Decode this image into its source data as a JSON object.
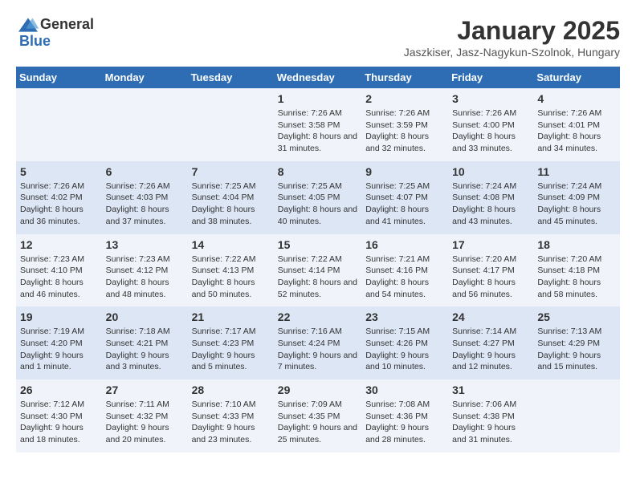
{
  "header": {
    "logo_general": "General",
    "logo_blue": "Blue",
    "title": "January 2025",
    "subtitle": "Jaszkiser, Jasz-Nagykun-Szolnok, Hungary"
  },
  "days_of_week": [
    "Sunday",
    "Monday",
    "Tuesday",
    "Wednesday",
    "Thursday",
    "Friday",
    "Saturday"
  ],
  "weeks": [
    [
      {
        "day": "",
        "info": ""
      },
      {
        "day": "",
        "info": ""
      },
      {
        "day": "",
        "info": ""
      },
      {
        "day": "1",
        "info": "Sunrise: 7:26 AM\nSunset: 3:58 PM\nDaylight: 8 hours and 31 minutes."
      },
      {
        "day": "2",
        "info": "Sunrise: 7:26 AM\nSunset: 3:59 PM\nDaylight: 8 hours and 32 minutes."
      },
      {
        "day": "3",
        "info": "Sunrise: 7:26 AM\nSunset: 4:00 PM\nDaylight: 8 hours and 33 minutes."
      },
      {
        "day": "4",
        "info": "Sunrise: 7:26 AM\nSunset: 4:01 PM\nDaylight: 8 hours and 34 minutes."
      }
    ],
    [
      {
        "day": "5",
        "info": "Sunrise: 7:26 AM\nSunset: 4:02 PM\nDaylight: 8 hours and 36 minutes."
      },
      {
        "day": "6",
        "info": "Sunrise: 7:26 AM\nSunset: 4:03 PM\nDaylight: 8 hours and 37 minutes."
      },
      {
        "day": "7",
        "info": "Sunrise: 7:25 AM\nSunset: 4:04 PM\nDaylight: 8 hours and 38 minutes."
      },
      {
        "day": "8",
        "info": "Sunrise: 7:25 AM\nSunset: 4:05 PM\nDaylight: 8 hours and 40 minutes."
      },
      {
        "day": "9",
        "info": "Sunrise: 7:25 AM\nSunset: 4:07 PM\nDaylight: 8 hours and 41 minutes."
      },
      {
        "day": "10",
        "info": "Sunrise: 7:24 AM\nSunset: 4:08 PM\nDaylight: 8 hours and 43 minutes."
      },
      {
        "day": "11",
        "info": "Sunrise: 7:24 AM\nSunset: 4:09 PM\nDaylight: 8 hours and 45 minutes."
      }
    ],
    [
      {
        "day": "12",
        "info": "Sunrise: 7:23 AM\nSunset: 4:10 PM\nDaylight: 8 hours and 46 minutes."
      },
      {
        "day": "13",
        "info": "Sunrise: 7:23 AM\nSunset: 4:12 PM\nDaylight: 8 hours and 48 minutes."
      },
      {
        "day": "14",
        "info": "Sunrise: 7:22 AM\nSunset: 4:13 PM\nDaylight: 8 hours and 50 minutes."
      },
      {
        "day": "15",
        "info": "Sunrise: 7:22 AM\nSunset: 4:14 PM\nDaylight: 8 hours and 52 minutes."
      },
      {
        "day": "16",
        "info": "Sunrise: 7:21 AM\nSunset: 4:16 PM\nDaylight: 8 hours and 54 minutes."
      },
      {
        "day": "17",
        "info": "Sunrise: 7:20 AM\nSunset: 4:17 PM\nDaylight: 8 hours and 56 minutes."
      },
      {
        "day": "18",
        "info": "Sunrise: 7:20 AM\nSunset: 4:18 PM\nDaylight: 8 hours and 58 minutes."
      }
    ],
    [
      {
        "day": "19",
        "info": "Sunrise: 7:19 AM\nSunset: 4:20 PM\nDaylight: 9 hours and 1 minute."
      },
      {
        "day": "20",
        "info": "Sunrise: 7:18 AM\nSunset: 4:21 PM\nDaylight: 9 hours and 3 minutes."
      },
      {
        "day": "21",
        "info": "Sunrise: 7:17 AM\nSunset: 4:23 PM\nDaylight: 9 hours and 5 minutes."
      },
      {
        "day": "22",
        "info": "Sunrise: 7:16 AM\nSunset: 4:24 PM\nDaylight: 9 hours and 7 minutes."
      },
      {
        "day": "23",
        "info": "Sunrise: 7:15 AM\nSunset: 4:26 PM\nDaylight: 9 hours and 10 minutes."
      },
      {
        "day": "24",
        "info": "Sunrise: 7:14 AM\nSunset: 4:27 PM\nDaylight: 9 hours and 12 minutes."
      },
      {
        "day": "25",
        "info": "Sunrise: 7:13 AM\nSunset: 4:29 PM\nDaylight: 9 hours and 15 minutes."
      }
    ],
    [
      {
        "day": "26",
        "info": "Sunrise: 7:12 AM\nSunset: 4:30 PM\nDaylight: 9 hours and 18 minutes."
      },
      {
        "day": "27",
        "info": "Sunrise: 7:11 AM\nSunset: 4:32 PM\nDaylight: 9 hours and 20 minutes."
      },
      {
        "day": "28",
        "info": "Sunrise: 7:10 AM\nSunset: 4:33 PM\nDaylight: 9 hours and 23 minutes."
      },
      {
        "day": "29",
        "info": "Sunrise: 7:09 AM\nSunset: 4:35 PM\nDaylight: 9 hours and 25 minutes."
      },
      {
        "day": "30",
        "info": "Sunrise: 7:08 AM\nSunset: 4:36 PM\nDaylight: 9 hours and 28 minutes."
      },
      {
        "day": "31",
        "info": "Sunrise: 7:06 AM\nSunset: 4:38 PM\nDaylight: 9 hours and 31 minutes."
      },
      {
        "day": "",
        "info": ""
      }
    ]
  ]
}
